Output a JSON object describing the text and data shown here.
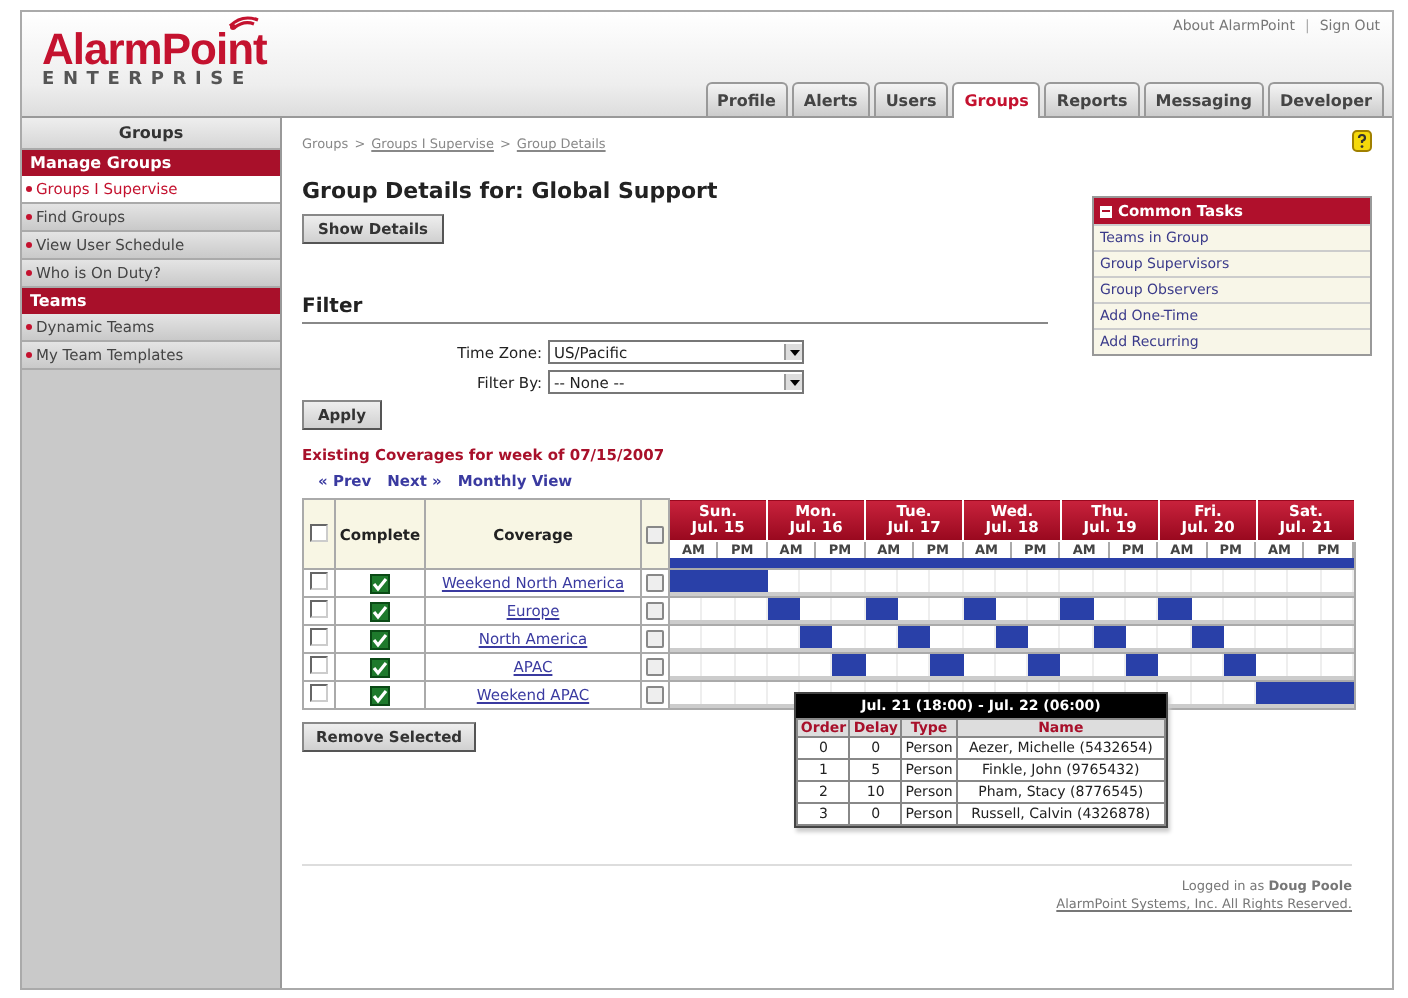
{
  "logo": {
    "name_part1": "Alarm",
    "name_part2": "Point",
    "edition": "ENTERPRISE"
  },
  "top_links": [
    "About AlarmPoint",
    "Sign Out"
  ],
  "top_links_separator": "|",
  "tabs": [
    {
      "label": "Profile",
      "selected": false
    },
    {
      "label": "Alerts",
      "selected": false
    },
    {
      "label": "Users",
      "selected": false
    },
    {
      "label": "Groups",
      "selected": true
    },
    {
      "label": "Reports",
      "selected": false
    },
    {
      "label": "Messaging",
      "selected": false
    },
    {
      "label": "Developer",
      "selected": false
    }
  ],
  "sidebar": {
    "title": "Groups",
    "items": [
      {
        "kind": "section",
        "label": "Manage Groups"
      },
      {
        "kind": "link",
        "label": "Groups I Supervise",
        "selected": true
      },
      {
        "kind": "link",
        "label": "Find Groups",
        "selected": false
      },
      {
        "kind": "link",
        "label": "View User Schedule",
        "selected": false
      },
      {
        "kind": "link",
        "label": "Who is On Duty?",
        "selected": false
      },
      {
        "kind": "section",
        "label": "Teams"
      },
      {
        "kind": "link",
        "label": "Dynamic Teams",
        "selected": false
      },
      {
        "kind": "link",
        "label": "My Team Templates",
        "selected": false
      }
    ]
  },
  "breadcrumb": [
    "Groups",
    "Groups I Supervise",
    "Group Details"
  ],
  "breadcrumb_separator": ">",
  "title": "Group Details for: Global Support",
  "show_details_button": "Show Details",
  "common_tasks": {
    "title": "Common Tasks",
    "items": [
      "Teams in Group",
      "Group Supervisors",
      "Group Observers",
      "Add One-Time",
      "Add Recurring"
    ]
  },
  "filter": {
    "heading": "Filter",
    "fields": [
      {
        "label": "Time Zone:",
        "value": "US/Pacific"
      },
      {
        "label": "Filter By:",
        "value": "-- None --"
      }
    ],
    "apply_button": "Apply"
  },
  "coverages": {
    "heading": "Existing Coverages for week of 07/15/2007",
    "nav": [
      "« Prev",
      "Next »",
      "Monthly View"
    ],
    "select_all_checked": false,
    "columns": [
      "Complete",
      "Coverage"
    ],
    "days": [
      {
        "day": "Sun.",
        "date": "Jul. 15",
        "halves": [
          "AM",
          "PM"
        ]
      },
      {
        "day": "Mon.",
        "date": "Jul. 16",
        "halves": [
          "AM",
          "PM"
        ]
      },
      {
        "day": "Tue.",
        "date": "Jul. 17",
        "halves": [
          "AM",
          "PM"
        ]
      },
      {
        "day": "Wed.",
        "date": "Jul. 18",
        "halves": [
          "AM",
          "PM"
        ]
      },
      {
        "day": "Thu.",
        "date": "Jul. 19",
        "halves": [
          "AM",
          "PM"
        ]
      },
      {
        "day": "Fri.",
        "date": "Jul. 20",
        "halves": [
          "AM",
          "PM"
        ]
      },
      {
        "day": "Sat.",
        "date": "Jul. 21",
        "halves": [
          "AM",
          "PM"
        ]
      }
    ],
    "rows": [
      {
        "name": "Weekend North America",
        "checked": false,
        "complete": true,
        "shifts": [
          true,
          true,
          true,
          false,
          false,
          false,
          false,
          false,
          false,
          false,
          false,
          false,
          false,
          false,
          false,
          false,
          false,
          false,
          false,
          false,
          false
        ]
      },
      {
        "name": "Europe",
        "checked": false,
        "complete": true,
        "shifts": [
          false,
          false,
          false,
          true,
          false,
          false,
          true,
          false,
          false,
          true,
          false,
          false,
          true,
          false,
          false,
          true,
          false,
          false,
          false,
          false,
          false
        ]
      },
      {
        "name": "North America",
        "checked": false,
        "complete": true,
        "shifts": [
          false,
          false,
          false,
          false,
          true,
          false,
          false,
          true,
          false,
          false,
          true,
          false,
          false,
          true,
          false,
          false,
          true,
          false,
          false,
          false,
          false
        ]
      },
      {
        "name": "APAC",
        "checked": false,
        "complete": true,
        "shifts": [
          false,
          false,
          false,
          false,
          false,
          true,
          false,
          false,
          true,
          false,
          false,
          true,
          false,
          false,
          true,
          false,
          false,
          true,
          false,
          false,
          false
        ]
      },
      {
        "name": "Weekend APAC",
        "checked": false,
        "complete": true,
        "shifts": [
          false,
          false,
          false,
          false,
          false,
          false,
          false,
          false,
          false,
          false,
          false,
          false,
          false,
          false,
          false,
          false,
          false,
          false,
          true,
          true,
          true
        ]
      }
    ],
    "remove_button": "Remove Selected",
    "tooltip": {
      "title": "Jul. 21 (18:00) - Jul. 22 (06:00)",
      "columns": [
        "Order",
        "Delay",
        "Type",
        "Name"
      ],
      "rows": [
        [
          "0",
          "0",
          "Person",
          "Aezer, Michelle (5432654)"
        ],
        [
          "1",
          "5",
          "Person",
          "Finkle, John (9765432)"
        ],
        [
          "2",
          "10",
          "Person",
          "Pham, Stacy (8776545)"
        ],
        [
          "3",
          "0",
          "Person",
          "Russell, Calvin (4326878)"
        ]
      ]
    }
  },
  "footer": {
    "logged_in": "Logged in as **Doug Poole**",
    "copyright": "AlarmPoint Systems, Inc. All Rights Reserved."
  }
}
